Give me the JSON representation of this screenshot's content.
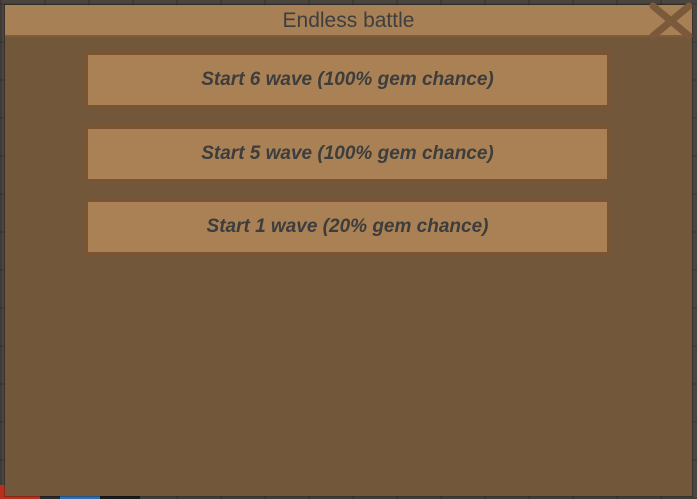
{
  "dialog": {
    "title": "Endless battle",
    "close_icon": "close-x-icon"
  },
  "buttons": [
    {
      "label": "Start 6 wave (100% gem chance)"
    },
    {
      "label": "Start 5 wave (100% gem chance)"
    },
    {
      "label": "Start 1 wave (20% gem chance)"
    }
  ],
  "colors": {
    "panel": "#73573a",
    "title_bar": "#a88056",
    "button_fill": "#a98155",
    "button_border": "#7b5431",
    "text": "#3d3d3d"
  }
}
